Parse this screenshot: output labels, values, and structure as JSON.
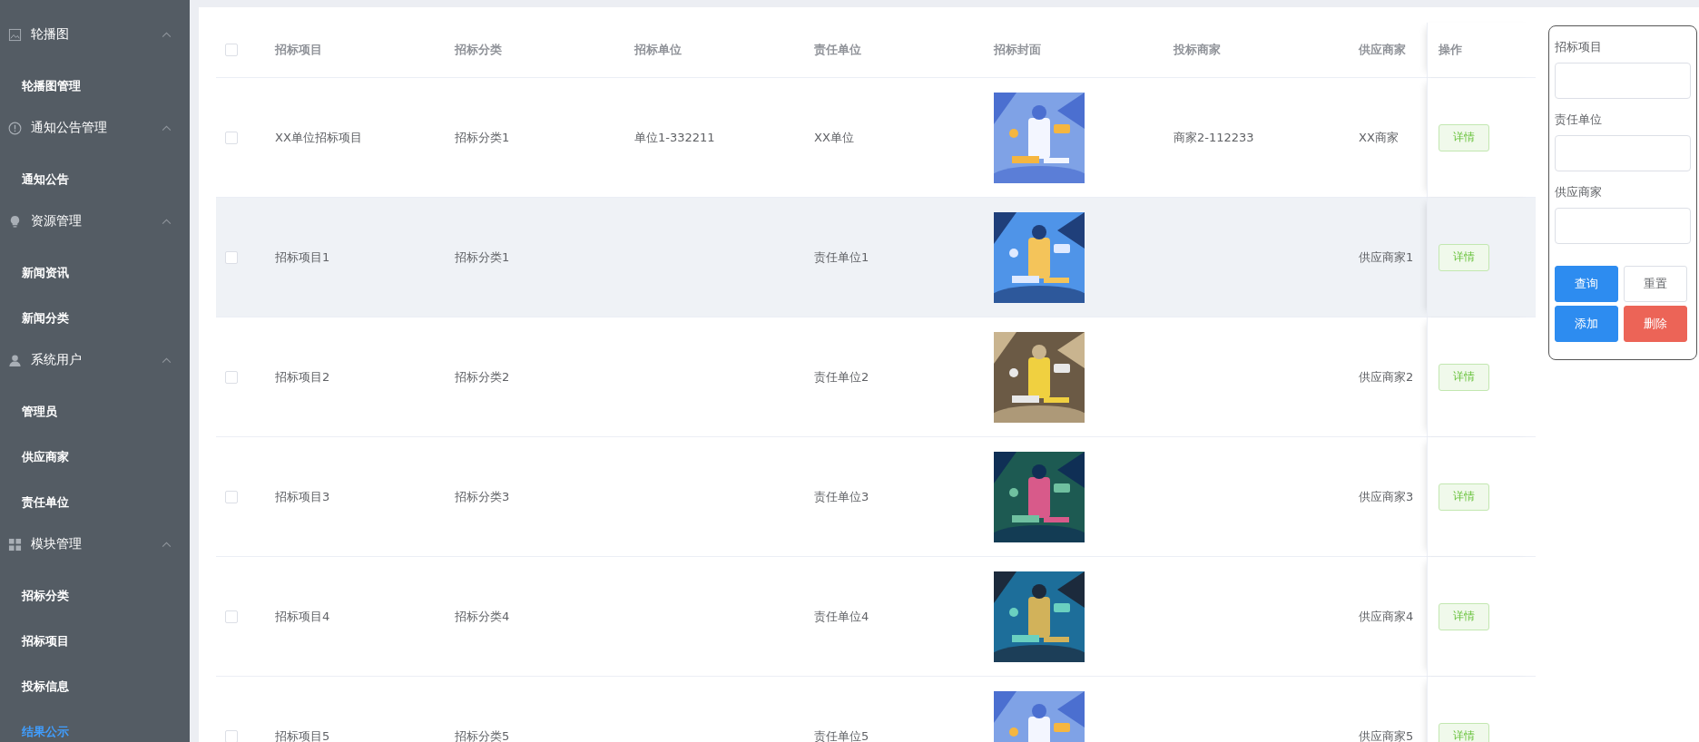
{
  "sidebar": {
    "groups": [
      {
        "label": "轮播图",
        "expanded": true,
        "items": [
          {
            "label": "轮播图管理",
            "selected": false
          }
        ]
      },
      {
        "label": "通知公告管理",
        "expanded": true,
        "items": [
          {
            "label": "通知公告",
            "selected": false
          }
        ]
      },
      {
        "label": "资源管理",
        "expanded": true,
        "items": [
          {
            "label": "新闻资讯",
            "selected": false
          },
          {
            "label": "新闻分类",
            "selected": false
          }
        ]
      },
      {
        "label": "系统用户",
        "expanded": true,
        "items": [
          {
            "label": "管理员",
            "selected": false
          },
          {
            "label": "供应商家",
            "selected": false
          },
          {
            "label": "责任单位",
            "selected": false
          }
        ]
      },
      {
        "label": "模块管理",
        "expanded": true,
        "items": [
          {
            "label": "招标分类",
            "selected": false
          },
          {
            "label": "招标项目",
            "selected": false
          },
          {
            "label": "投标信息",
            "selected": false
          },
          {
            "label": "结果公示",
            "selected": true
          }
        ]
      }
    ]
  },
  "table": {
    "columns": [
      "招标项目",
      "招标分类",
      "招标单位",
      "责任单位",
      "招标封面",
      "投标商家",
      "供应商家",
      "操作"
    ],
    "all_checked": false,
    "rows": [
      {
        "checked": false,
        "hovered": false,
        "project": "XX单位招标项目",
        "category": "招标分类1",
        "bidder_unit": "单位1-332211",
        "responsible_unit": "XX单位",
        "bid_merchant": "商家2-112233",
        "supplier": "XX商家",
        "action": "详情"
      },
      {
        "checked": false,
        "hovered": true,
        "project": "招标项目1",
        "category": "招标分类1",
        "responsible_unit": "责任单位1",
        "supplier": "供应商家1",
        "action": "详情"
      },
      {
        "checked": false,
        "hovered": false,
        "project": "招标项目2",
        "category": "招标分类2",
        "responsible_unit": "责任单位2",
        "supplier": "供应商家2",
        "action": "详情"
      },
      {
        "checked": false,
        "hovered": false,
        "project": "招标项目3",
        "category": "招标分类3",
        "responsible_unit": "责任单位3",
        "supplier": "供应商家3",
        "action": "详情"
      },
      {
        "checked": false,
        "hovered": false,
        "project": "招标项目4",
        "category": "招标分类4",
        "responsible_unit": "责任单位4",
        "supplier": "供应商家4",
        "action": "详情"
      },
      {
        "checked": false,
        "hovered": false,
        "project": "招标项目5",
        "category": "招标分类5",
        "responsible_unit": "责任单位5",
        "supplier": "供应商家5",
        "action": "详情"
      }
    ]
  },
  "search_panel": {
    "fields": [
      {
        "label": "招标项目"
      },
      {
        "label": "责任单位"
      },
      {
        "label": "供应商家"
      }
    ],
    "buttons": [
      {
        "label": "查询",
        "kind": "primary"
      },
      {
        "label": "重置",
        "kind": "plain"
      },
      {
        "label": "添加",
        "kind": "primary"
      },
      {
        "label": "删除",
        "kind": "danger"
      }
    ]
  }
}
